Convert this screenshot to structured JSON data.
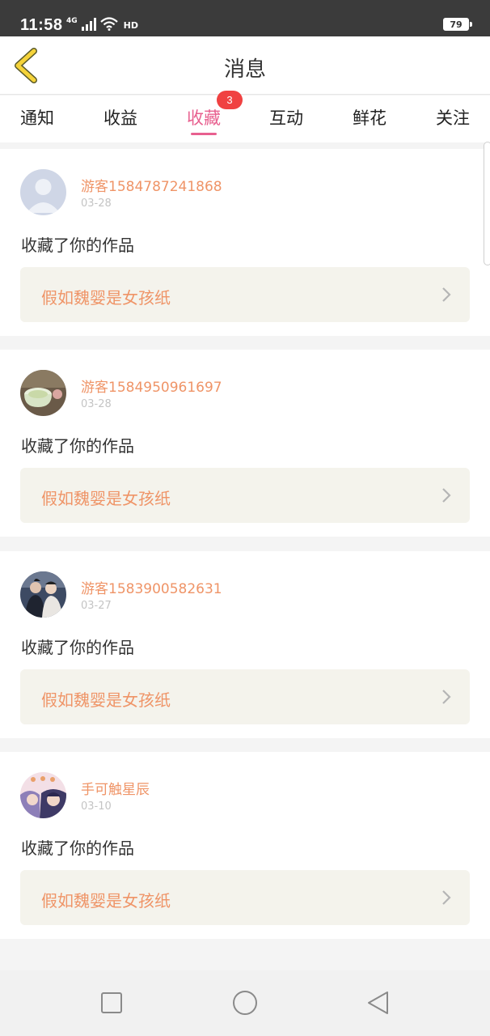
{
  "status_bar": {
    "time": "11:58",
    "network": "4G",
    "hd": "HD",
    "battery": "79"
  },
  "header": {
    "title": "消息"
  },
  "tabs": [
    {
      "label": "通知",
      "active": false
    },
    {
      "label": "收益",
      "active": false
    },
    {
      "label": "收藏",
      "active": true,
      "badge": "3"
    },
    {
      "label": "互动",
      "active": false
    },
    {
      "label": "鲜花",
      "active": false
    },
    {
      "label": "关注",
      "active": false
    }
  ],
  "messages": [
    {
      "username": "游客1584787241868",
      "date": "03-28",
      "action": "收藏了你的作品",
      "work_title": "假如魏婴是女孩纸",
      "avatar": "default-avatar"
    },
    {
      "username": "游客1584950961697",
      "date": "03-28",
      "action": "收藏了你的作品",
      "work_title": "假如魏婴是女孩纸",
      "avatar": "teacup-photo-avatar"
    },
    {
      "username": "游客1583900582631",
      "date": "03-27",
      "action": "收藏了你的作品",
      "work_title": "假如魏婴是女孩纸",
      "avatar": "two-people-photo-avatar"
    },
    {
      "username": "手可触星辰",
      "date": "03-10",
      "action": "收藏了你的作品",
      "work_title": "假如魏婴是女孩纸",
      "avatar": "anime-photo-avatar"
    }
  ],
  "colors": {
    "accent_pink": "#e8608f",
    "name_orange": "#ef9467",
    "badge_red": "#f04141",
    "back_arrow": "#f5d33a"
  }
}
